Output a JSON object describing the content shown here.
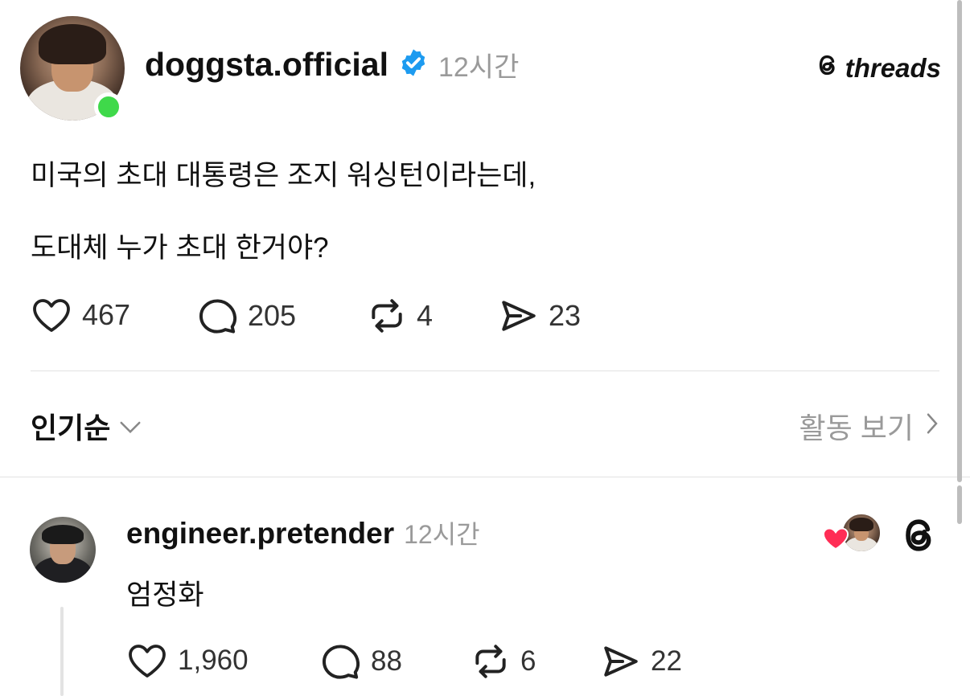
{
  "post": {
    "username": "doggsta.official",
    "time": "12시간",
    "line1": "미국의 초대 대통령은 조지 워싱턴이라는데,",
    "line2": "도대체 누가 초대 한거야?",
    "likes": "467",
    "comments": "205",
    "reposts": "4",
    "shares": "23"
  },
  "brand": {
    "logo_text": "threads"
  },
  "sort_bar": {
    "sort_label": "인기순",
    "activity_label": "활동 보기"
  },
  "reply": {
    "username": "engineer.pretender",
    "time": "12시간",
    "text": "엄정화",
    "likes": "1,960",
    "comments": "88",
    "reposts": "6",
    "shares": "22"
  },
  "colors": {
    "verified": "#1d9bf0",
    "online": "#3fd94a",
    "heart": "#ff2d55"
  },
  "icons": [
    "verified-badge-icon",
    "threads-logo-icon",
    "heart-icon",
    "comment-icon",
    "repost-icon",
    "share-icon",
    "chevron-down-icon",
    "chevron-right-icon"
  ]
}
